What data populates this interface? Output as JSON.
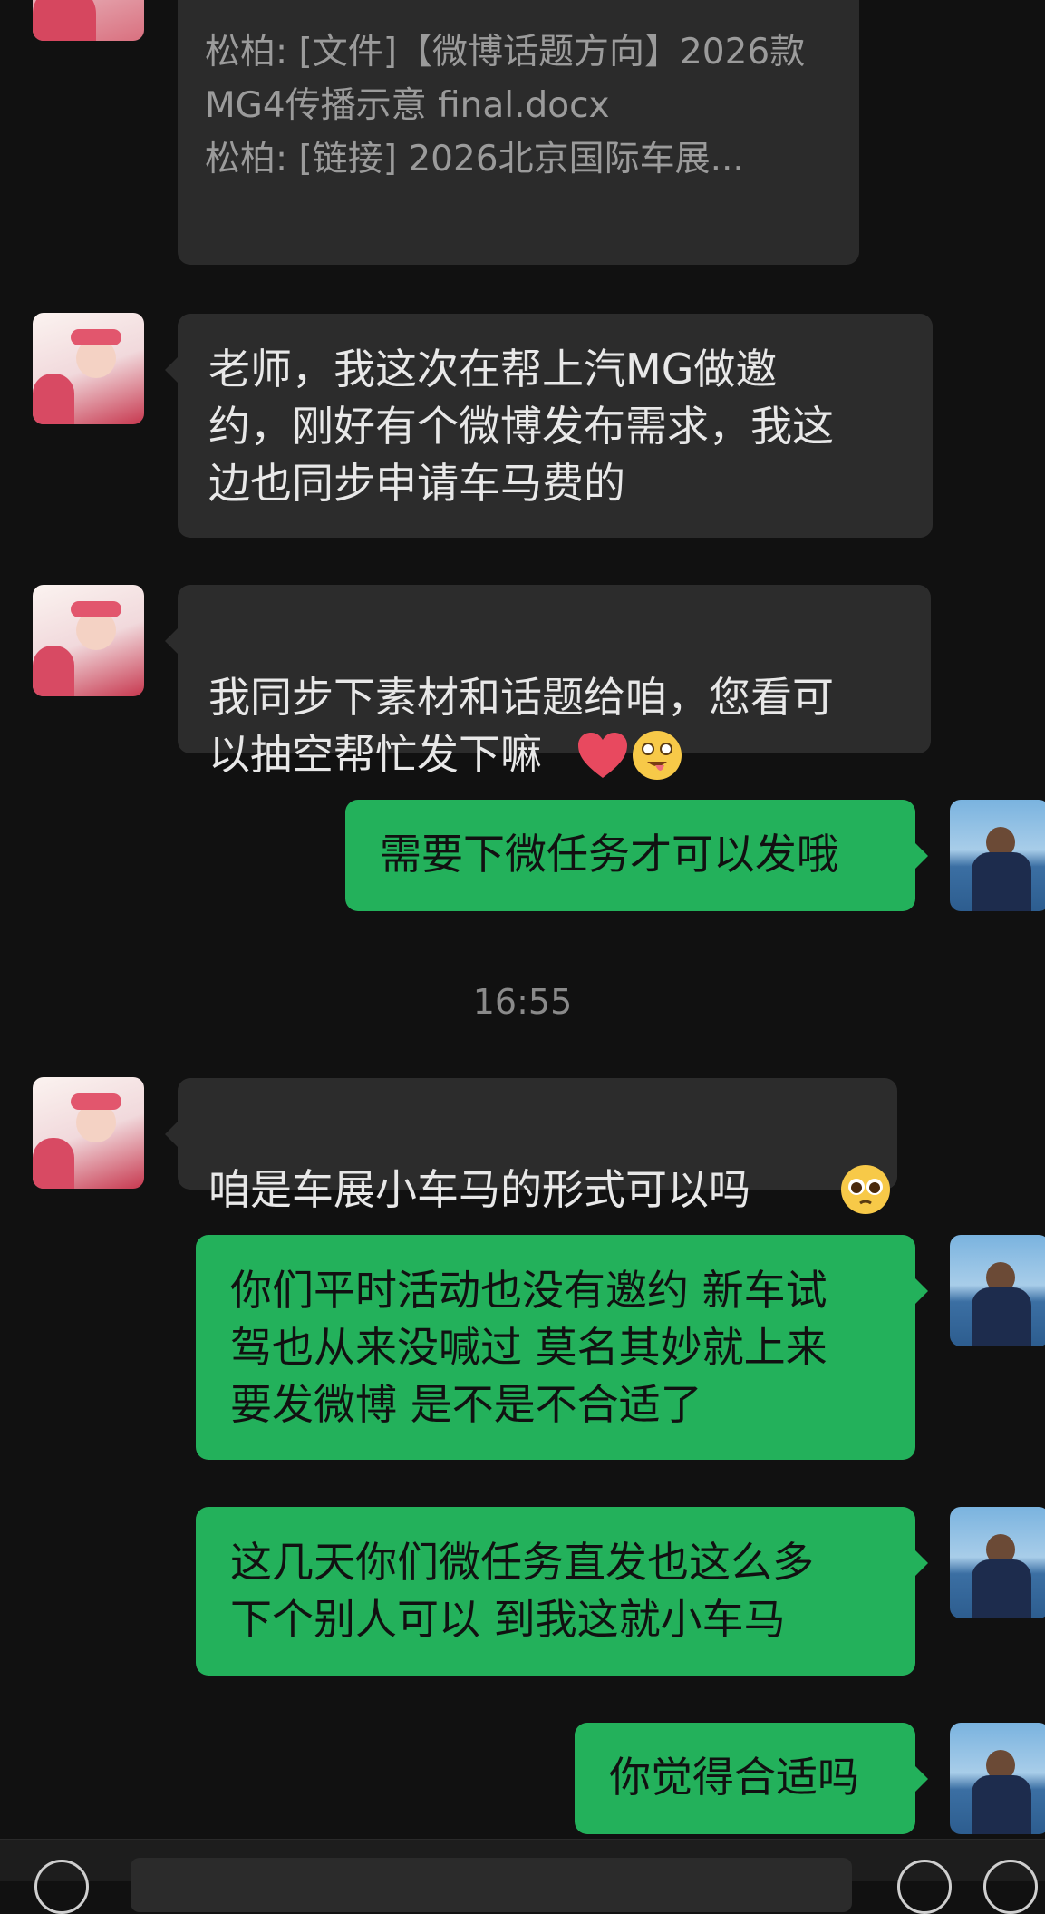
{
  "quote_card": {
    "line1": "松柏: [文件]【微博话题方向】2026款",
    "line2": "MG4传播示意 final.docx",
    "line3": "松柏: [链接] 2026北京国际车展..."
  },
  "messages": [
    {
      "text": "老师，我这次在帮上汽MG做邀\n约，刚好有个微博发布需求，我这\n边也同步申请车马费的"
    },
    {
      "text": "我同步下素材和话题给咱，您看可\n以抽空帮忙发下嘛",
      "emojis": [
        "red-heart",
        "zany-face"
      ]
    },
    {
      "text": "需要下微任务才可以发哦"
    },
    {
      "text": "咱是车展小车马的形式可以吗",
      "emojis": [
        "pleading-face"
      ]
    },
    {
      "text": "你们平时活动也没有邀约 新车试\n驾也从来没喊过 莫名其妙就上来\n要发微博 是不是不合适了"
    },
    {
      "text": "这几天你们微任务直发也这么多\n下个别人可以 到我这就小车马"
    },
    {
      "text": "你觉得合适吗"
    }
  ],
  "timestamp": "16:55",
  "colors": {
    "background": "#111111",
    "incoming_bubble": "#2c2c2c",
    "outgoing_bubble": "#23b15b"
  }
}
